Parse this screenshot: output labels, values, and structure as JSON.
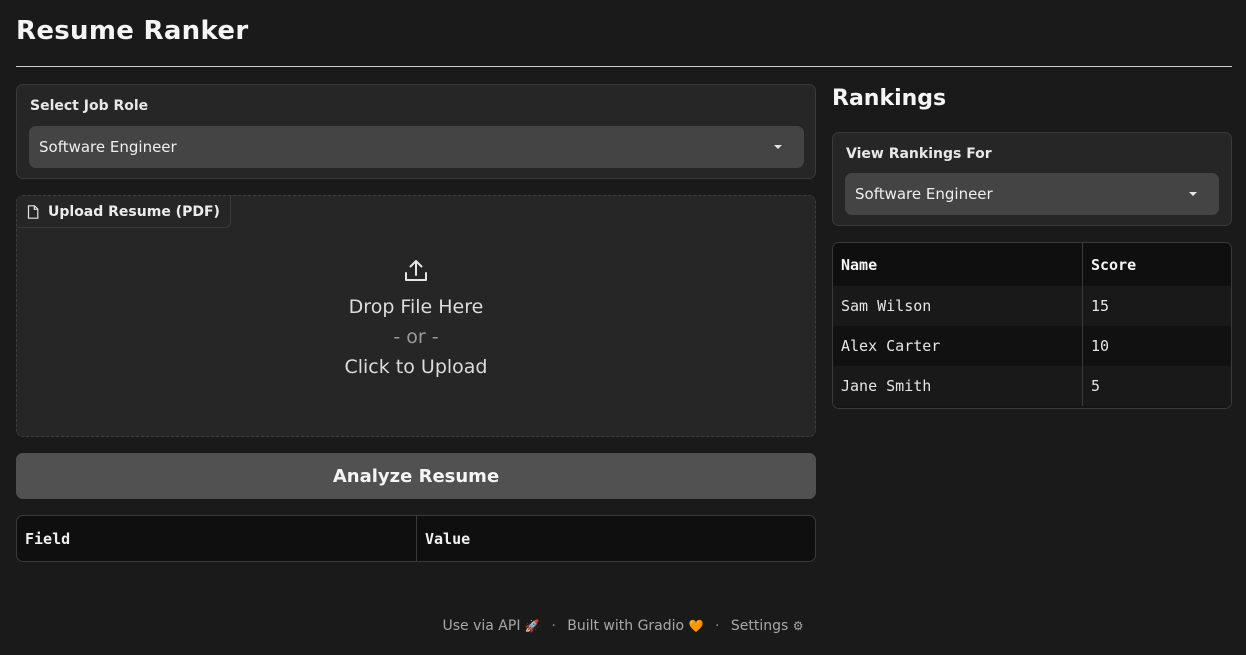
{
  "app": {
    "title": "Resume Ranker"
  },
  "job_role": {
    "label": "Select Job Role",
    "selected": "Software Engineer"
  },
  "upload": {
    "tab_label": "Upload Resume (PDF)",
    "drop_text": "Drop File Here",
    "or_text": "- or -",
    "click_text": "Click to Upload"
  },
  "analyze": {
    "button_label": "Analyze Resume"
  },
  "result_table": {
    "columns": [
      "Field",
      "Value"
    ]
  },
  "rankings": {
    "heading": "Rankings",
    "filter_label": "View Rankings For",
    "selected": "Software Engineer",
    "columns": [
      "Name",
      "Score"
    ],
    "rows": [
      {
        "name": "Sam Wilson",
        "score": "15"
      },
      {
        "name": "Alex Carter",
        "score": "10"
      },
      {
        "name": "Jane Smith",
        "score": "5"
      }
    ]
  },
  "footer": {
    "api_link": "Use via API",
    "api_icon": "🚀",
    "built_with": "Built with Gradio",
    "gradio_icon": "🧡",
    "settings": "Settings",
    "settings_icon": "⚙",
    "separator": "·"
  },
  "colors": {
    "background": "#1a1a1a",
    "panel": "#262626",
    "button": "#515151",
    "select": "#444444"
  }
}
